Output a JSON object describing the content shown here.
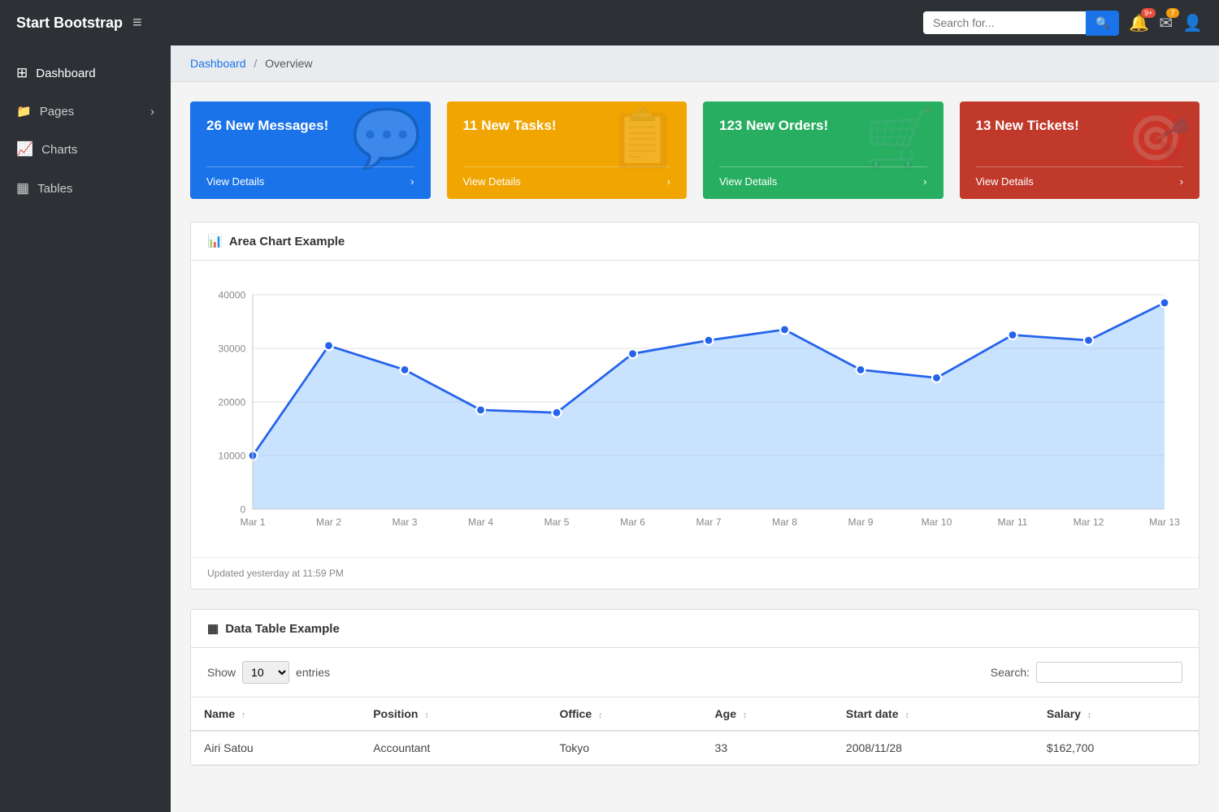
{
  "topnav": {
    "brand": "Start Bootstrap",
    "hamburger_icon": "≡",
    "search_placeholder": "Search for...",
    "search_icon": "🔍",
    "bell_badge": "9+",
    "mail_badge": "7",
    "user_icon": "👤"
  },
  "breadcrumb": {
    "home": "Dashboard",
    "current": "Overview",
    "separator": "/"
  },
  "sidebar": {
    "items": [
      {
        "id": "dashboard",
        "label": "Dashboard",
        "icon": "⊞",
        "active": true
      },
      {
        "id": "pages",
        "label": "Pages",
        "icon": "📁",
        "hasArrow": true
      },
      {
        "id": "charts",
        "label": "Charts",
        "icon": "📈"
      },
      {
        "id": "tables",
        "label": "Tables",
        "icon": "▦"
      }
    ]
  },
  "stat_cards": [
    {
      "id": "messages",
      "title": "26 New Messages!",
      "link": "View Details",
      "color": "blue",
      "icon": "💬"
    },
    {
      "id": "tasks",
      "title": "11 New Tasks!",
      "link": "View Details",
      "color": "yellow",
      "icon": "📋"
    },
    {
      "id": "orders",
      "title": "123 New Orders!",
      "link": "View Details",
      "color": "green",
      "icon": "🛒"
    },
    {
      "id": "tickets",
      "title": "13 New Tickets!",
      "link": "View Details",
      "color": "red",
      "icon": "🎯"
    }
  ],
  "area_chart": {
    "title": "Area Chart Example",
    "title_icon": "📊",
    "footer": "Updated yesterday at 11:59 PM",
    "labels": [
      "Mar 1",
      "Mar 2",
      "Mar 3",
      "Mar 4",
      "Mar 5",
      "Mar 6",
      "Mar 7",
      "Mar 8",
      "Mar 9",
      "Mar 10",
      "Mar 11",
      "Mar 12",
      "Mar 13"
    ],
    "values": [
      10000,
      30500,
      26000,
      18500,
      18000,
      29000,
      31500,
      33500,
      26000,
      24500,
      32500,
      31500,
      38500
    ],
    "y_labels": [
      "0",
      "10000",
      "20000",
      "30000",
      "40000"
    ],
    "y_max": 40000,
    "stroke_color": "#2563eb",
    "fill_color": "rgba(147, 197, 253, 0.5)"
  },
  "data_table": {
    "title": "Data Table Example",
    "title_icon": "▦",
    "show_label": "Show",
    "entries_label": "entries",
    "show_value": "10",
    "search_label": "Search:",
    "search_placeholder": "",
    "columns": [
      {
        "label": "Name",
        "sortable": true
      },
      {
        "label": "Position",
        "sortable": true
      },
      {
        "label": "Office",
        "sortable": true
      },
      {
        "label": "Age",
        "sortable": true
      },
      {
        "label": "Start date",
        "sortable": true
      },
      {
        "label": "Salary",
        "sortable": true
      }
    ],
    "rows": [
      {
        "name": "Airi Satou",
        "position": "Accountant",
        "office": "Tokyo",
        "age": "33",
        "start_date": "2008/11/28",
        "salary": "$162,700"
      }
    ]
  }
}
